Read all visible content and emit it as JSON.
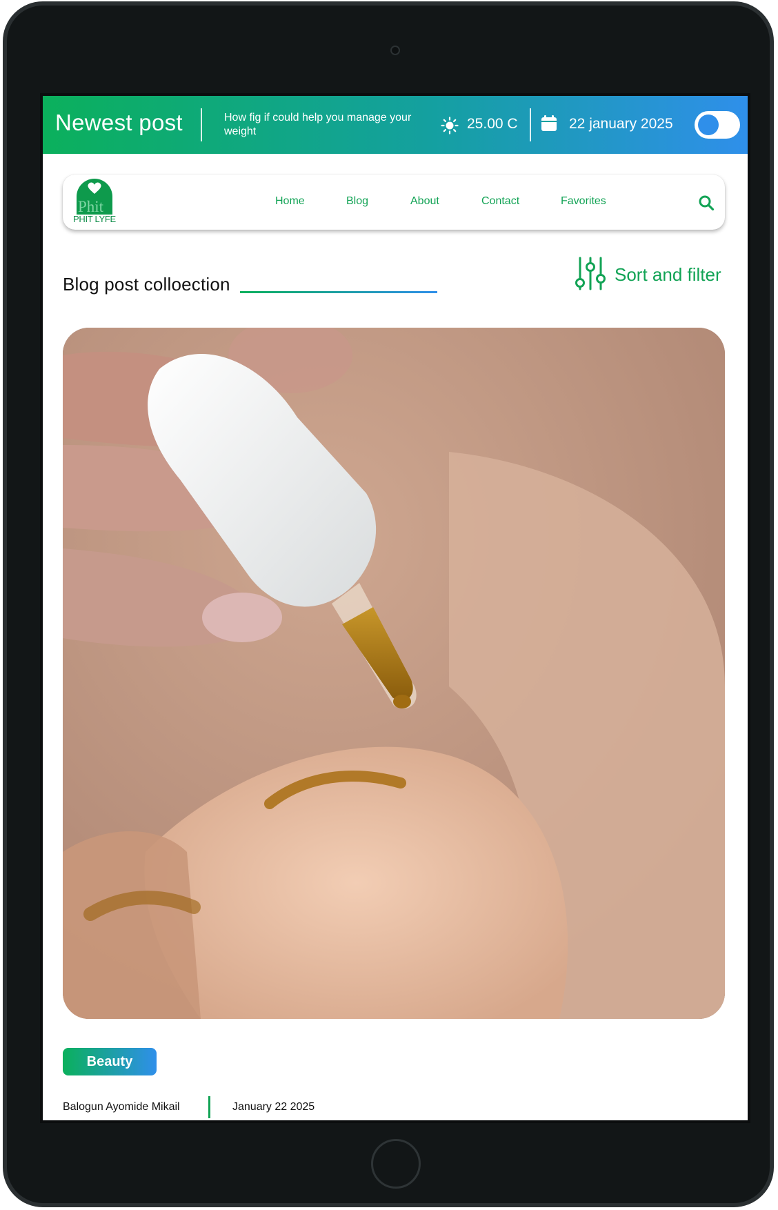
{
  "banner": {
    "title": "Newest post",
    "post_title": "How fig if could help you manage your weight",
    "weather_icon": "sun-icon",
    "temperature": "25.00 C",
    "calendar_icon": "calendar-icon",
    "date": "22 january 2025",
    "toggle_on": false
  },
  "nav": {
    "logo_mark": "Phit",
    "logo_text": "PHIT LYFE",
    "items": [
      "Home",
      "Blog",
      "About",
      "Contact",
      "Favorites"
    ],
    "search_icon": "search-icon"
  },
  "section": {
    "heading": "Blog post colloection",
    "sort_label": "Sort and filter",
    "sort_icon": "sliders-icon"
  },
  "post": {
    "image_alt": "Dropper applying oil to hand",
    "tag": "Beauty",
    "author": "Balogun Ayomide Mikail",
    "date": "January 22 2025"
  },
  "colors": {
    "brand_green": "#12a355",
    "brand_blue": "#2f8fea",
    "device_frame": "#121617"
  }
}
